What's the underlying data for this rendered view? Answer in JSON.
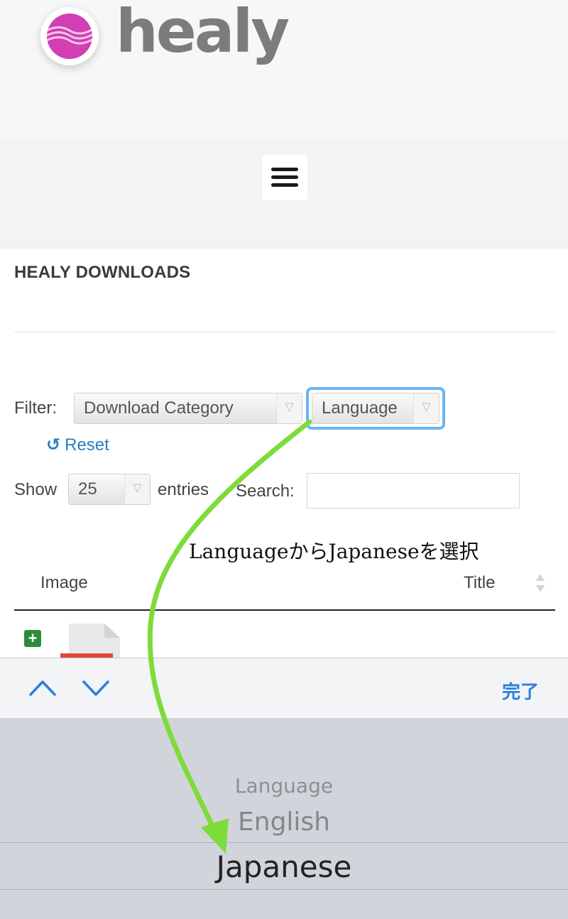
{
  "header": {
    "brand": "healy"
  },
  "page": {
    "title": "HEALY DOWNLOADS"
  },
  "filter": {
    "label": "Filter:",
    "category_value": "Download Category",
    "language_value": "Language",
    "reset_label": "Reset",
    "reset_icon": "↺"
  },
  "table_controls": {
    "show_label": "Show",
    "page_size": "25",
    "entries_label": "entries",
    "search_label": "Search:",
    "search_value": ""
  },
  "annotation": {
    "text": "LanguageからJapaneseを選択"
  },
  "table": {
    "headers": [
      "Image",
      "Title"
    ]
  },
  "keyboard": {
    "done_label": "完了"
  },
  "picker": {
    "options": [
      "Language",
      "English",
      "Japanese"
    ],
    "selected": "Japanese"
  },
  "colors": {
    "accent": "#2a7fc2",
    "highlight": "#6cb3f2",
    "annotation_arrow": "#7ddc3a",
    "brand_pink": "#d13fb2"
  }
}
